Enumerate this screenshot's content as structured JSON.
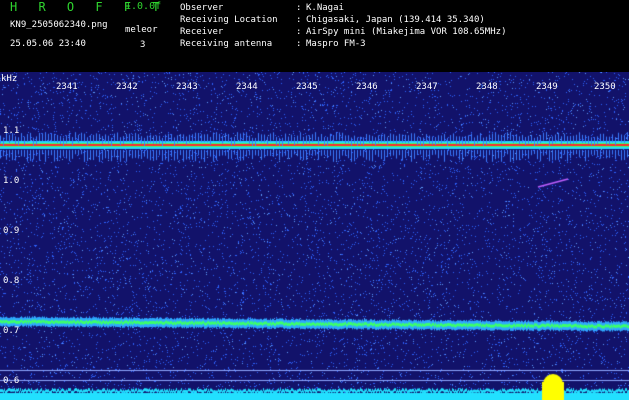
{
  "header": {
    "logo": "H R O F F T",
    "version": "1.0.0f",
    "filename": "KN9_2505062340.png",
    "meteor_label": "meleor",
    "datetime": "25.05.06 23:40",
    "meteor_count": "3",
    "info": [
      {
        "key": "Observer",
        "value": "K.Nagai"
      },
      {
        "key": "Receiving Location",
        "value": "Chigasaki, Japan (139.414 35.340)"
      },
      {
        "key": "Receiver",
        "value": "AirSpy mini (Miakejima VOR 108.65MHz)"
      },
      {
        "key": "Receiving antenna",
        "value": "Maspro FM-3"
      }
    ],
    "separator": ":"
  },
  "spectrogram": {
    "unit_label": "kHz",
    "y_ticks": [
      "1.1",
      "1.0",
      "0.9",
      "0.8",
      "0.7",
      "0.6"
    ],
    "x_ticks": [
      "2341",
      "2342",
      "2343",
      "2344",
      "2345",
      "2346",
      "2347",
      "2348",
      "2349",
      "2350"
    ],
    "colors": {
      "background": "#12126a",
      "noise": "#2e62ff",
      "carrier": "#ff2a2a",
      "band": "#3cff6a",
      "floor": "#22e0ff",
      "spot": "#ffff00"
    }
  }
}
